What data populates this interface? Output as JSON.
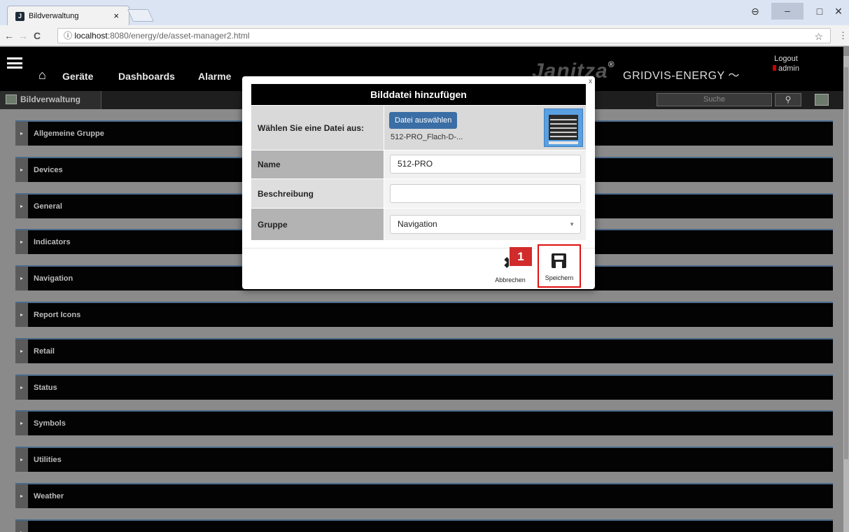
{
  "browser": {
    "tab_title": "Bildverwaltung",
    "tab_close": "×",
    "url_host": "localhost",
    "url_path": ":8080/energy/de/asset-manager2.html",
    "back": "←",
    "forward": "→",
    "reload": "C",
    "info": "ⓘ",
    "star": "☆",
    "menu": "⋮",
    "profile": "⊖",
    "minimize": "–",
    "maximize": "□",
    "close": "✕"
  },
  "header": {
    "home_icon": "⌂",
    "nav": [
      "Geräte",
      "Dashboards",
      "Alarme"
    ],
    "logo": "Janitza",
    "logo_reg": "®",
    "product": "GRIDVIS-ENERGY",
    "logout": "Logout",
    "user": "admin"
  },
  "subheader": {
    "title": "Bildverwaltung",
    "search_placeholder": "Suche",
    "search_icon": "⚲"
  },
  "groups": [
    {
      "label": "Allgemeine Gruppe"
    },
    {
      "label": "Devices"
    },
    {
      "label": "General"
    },
    {
      "label": "Indicators"
    },
    {
      "label": "Navigation"
    },
    {
      "label": "Report Icons"
    },
    {
      "label": "Retail"
    },
    {
      "label": "Status"
    },
    {
      "label": "Symbols"
    },
    {
      "label": "Utilities"
    },
    {
      "label": "Weather"
    },
    {
      "label": ""
    }
  ],
  "modal": {
    "title": "Bilddatei hinzufügen",
    "close": "x",
    "file_label": "Wählen Sie eine Datei aus:",
    "file_button": "Datei auswählen",
    "file_name": "512-PRO_Flach-D-...",
    "name_label": "Name",
    "name_value": "512-PRO",
    "desc_label": "Beschreibung",
    "desc_value": "",
    "group_label": "Gruppe",
    "group_value": "Navigation",
    "cancel_label": "Abbrechen",
    "save_label": "Speichern",
    "marker": "1"
  },
  "colors": {
    "accent_blue": "#3a6ea5",
    "highlight_red": "#e01010",
    "marker_red": "#d12b2b"
  }
}
